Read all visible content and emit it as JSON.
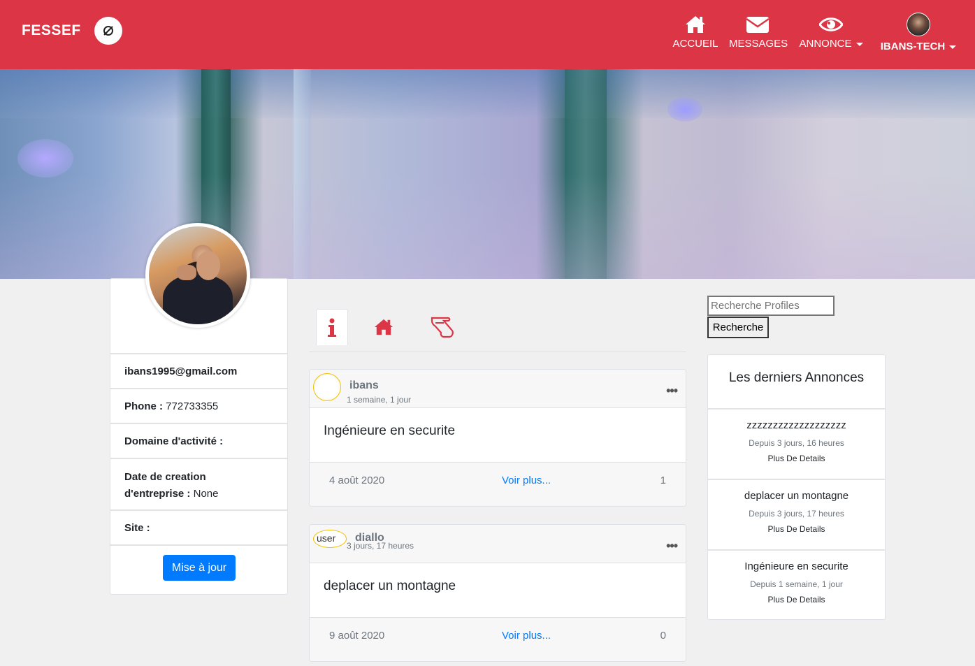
{
  "navbar": {
    "brand": "FESSEF",
    "items": [
      {
        "label": "ACCUEIL",
        "icon": "home-icon"
      },
      {
        "label": "MESSAGES",
        "icon": "envelope-icon"
      },
      {
        "label": "ANNONCE",
        "icon": "eye-icon"
      }
    ],
    "user": "IBANS-TECH"
  },
  "profile": {
    "email": "ibans1995@gmail.com",
    "phone_label": "Phone :",
    "phone": "772733355",
    "domaine_label": "Domaine d'activité :",
    "date_label_1": "Date de creation",
    "date_label_2": "d'entreprise :",
    "date_value": "None",
    "site_label": "Site :",
    "update_button": "Mise à jour"
  },
  "tabs": [
    {
      "icon": "info-icon"
    },
    {
      "icon": "home-icon"
    },
    {
      "icon": "pointing-hand-icon"
    }
  ],
  "posts": [
    {
      "author": "ibans",
      "time": "1 semaine, 1 jour",
      "title": "Ingénieure en securite",
      "date": "4 août 2020",
      "link": "Voir plus...",
      "count": "1"
    },
    {
      "author": "diallo",
      "avatar_alt": "user",
      "time": "3 jours, 17 heures",
      "title": "deplacer un montagne",
      "date": "9 août 2020",
      "link": "Voir plus...",
      "count": "0"
    }
  ],
  "sidebar": {
    "search_placeholder": "Recherche Profiles",
    "search_button": "Recherche",
    "annonces_title": "Les derniers Annonces",
    "annonces": [
      {
        "title": "zzzzzzzzzzzzzzzzzzz",
        "time": "Depuis 3 jours, 16 heures",
        "more": "Plus De Details"
      },
      {
        "title": "deplacer un montagne",
        "time": "Depuis 3 jours, 17 heures",
        "more": "Plus De Details"
      },
      {
        "title": "Ingénieure en securite",
        "time": "Depuis 1 semaine, 1 jour",
        "more": "Plus De Details"
      }
    ]
  },
  "colors": {
    "primary": "#dc3545",
    "link": "#007bff"
  }
}
